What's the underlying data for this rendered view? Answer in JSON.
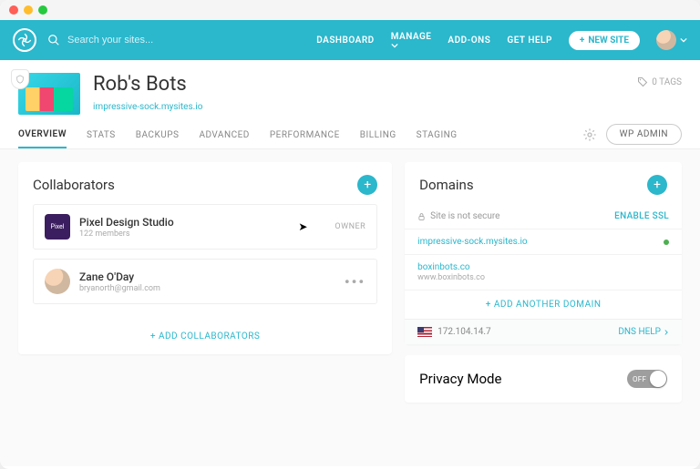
{
  "search": {
    "placeholder": "Search your sites..."
  },
  "nav": {
    "dashboard": "DASHBOARD",
    "manage": "MANAGE",
    "addons": "ADD-ONS",
    "gethelp": "GET HELP",
    "newsite": "NEW SITE"
  },
  "site": {
    "title": "Rob's Bots",
    "url": "impressive-sock.mysites.io",
    "tags": "0 TAGS"
  },
  "tabs": {
    "overview": "OVERVIEW",
    "stats": "STATS",
    "backups": "BACKUPS",
    "advanced": "ADVANCED",
    "performance": "PERFORMANCE",
    "billing": "BILLING",
    "staging": "STAGING",
    "wpadmin": "WP ADMIN"
  },
  "collaborators": {
    "heading": "Collaborators",
    "items": [
      {
        "name": "Pixel Design Studio",
        "sub": "122 members",
        "badge": "OWNER",
        "avatar_label": "Pixel"
      },
      {
        "name": "Zane O'Day",
        "sub": "bryanorth@gmail.com"
      }
    ],
    "add": "+  ADD COLLABORATORS"
  },
  "domains": {
    "heading": "Domains",
    "secure_label": "Site is not secure",
    "enable_ssl": "ENABLE SSL",
    "primary": "impressive-sock.mysites.io",
    "secondary": {
      "domain": "boxinbots.co",
      "sub": "www.boxinbots.co"
    },
    "add": "+  ADD ANOTHER DOMAIN",
    "ip": "172.104.14.7",
    "dns_help": "DNS HELP"
  },
  "privacy": {
    "heading": "Privacy Mode",
    "toggle": "OFF"
  }
}
